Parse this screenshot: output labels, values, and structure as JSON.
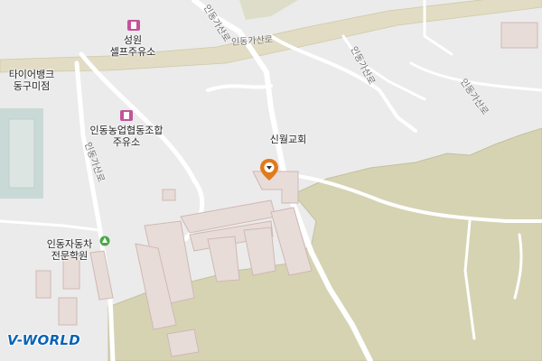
{
  "map": {
    "colors": {
      "background": "#ebebeb",
      "green_area": "#d6d3b3",
      "green_edge": "#c3c0a0",
      "road": "#ffffff",
      "main_road": "#e1dcc3",
      "building": "#e8dcd8",
      "building_edge": "#cfb8b4",
      "water": "#c9d9d6",
      "pin": "#e07b1c",
      "fuel_icon": "#c2549a",
      "bus_icon": "#4aa845"
    },
    "pois": [
      {
        "name": "seongwon-self-gas-station",
        "line1": "성원",
        "line2": "셀프주유소",
        "icon": "fuel-icon"
      },
      {
        "name": "tire-bank-donggu-store",
        "line1": "타이어뱅크",
        "line2": "동구미점",
        "icon": ""
      },
      {
        "name": "indong-nonghyup-gas-station",
        "line1": "인동농업협동조합",
        "line2": "주유소",
        "icon": "fuel-icon"
      },
      {
        "name": "sinwol-church",
        "line1": "신월교회",
        "line2": "",
        "icon": "location-pin-icon"
      },
      {
        "name": "indong-driving-school",
        "line1": "인동자동차",
        "line2": "전문학원",
        "icon": "school-icon"
      }
    ],
    "road_labels": [
      "인동가산로",
      "인동가산로",
      "인동가산로",
      "인동가산로"
    ],
    "logo": "V-WORLD"
  }
}
